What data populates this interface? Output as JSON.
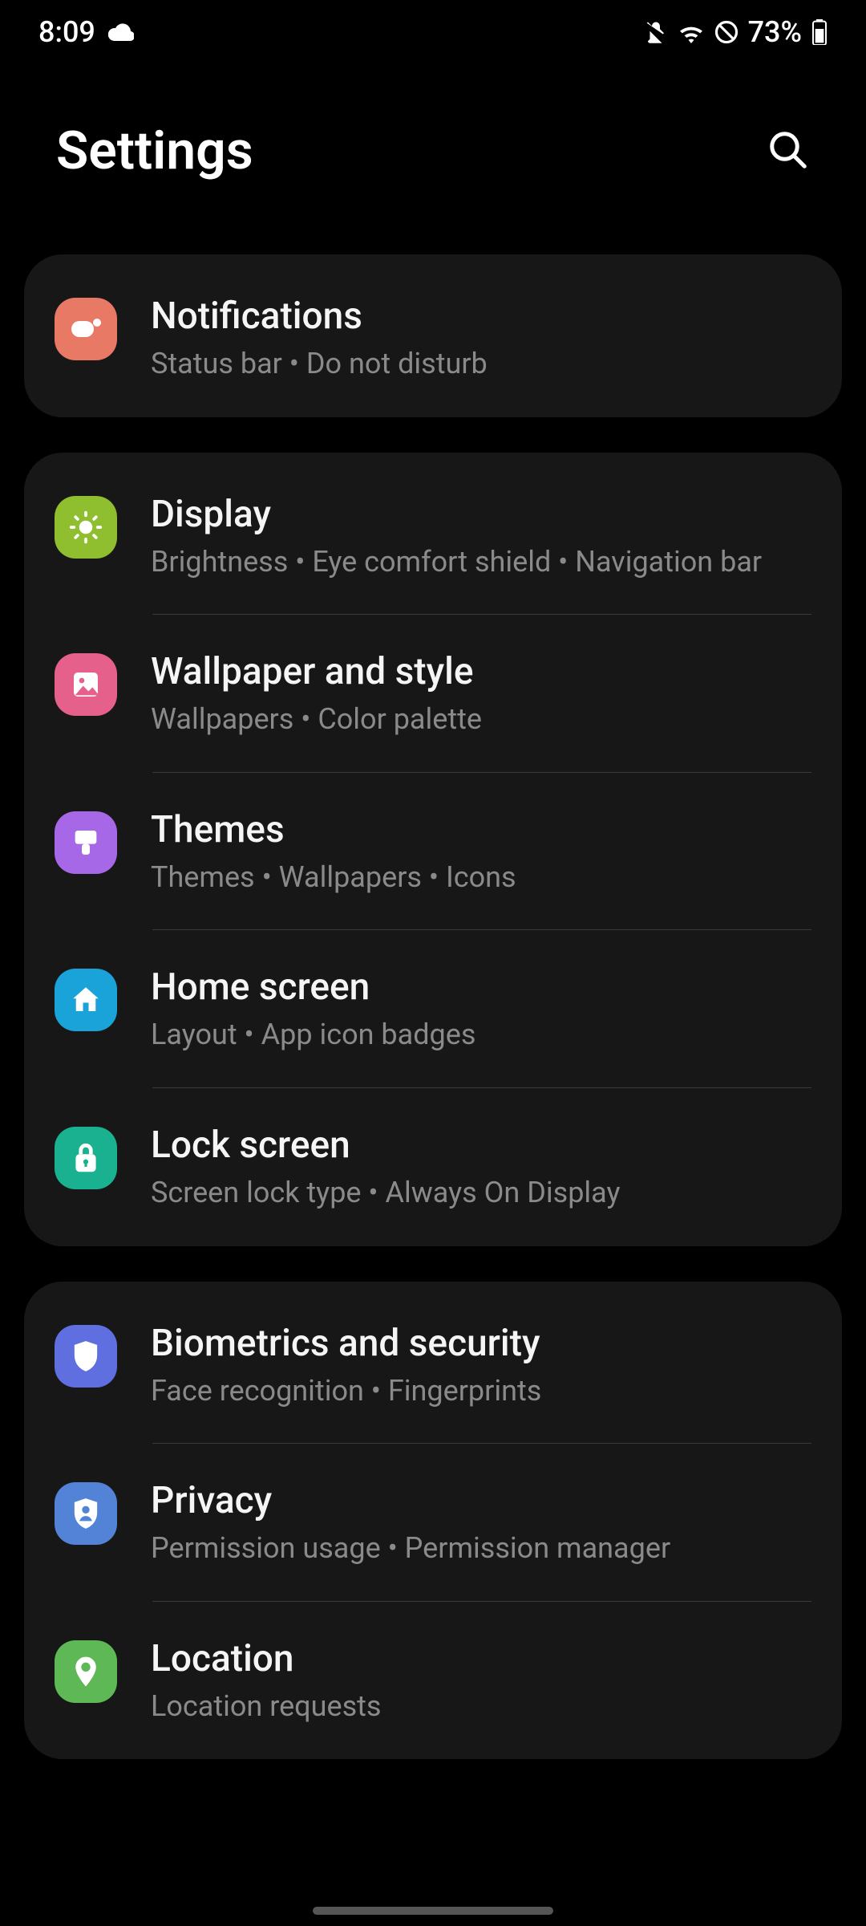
{
  "status": {
    "time": "8:09",
    "battery": "73%"
  },
  "header": {
    "title": "Settings"
  },
  "groups": [
    {
      "items": [
        {
          "icon": "notifications",
          "color": "#E87965",
          "title": "Notifications",
          "sub": "Status bar  •  Do not disturb"
        }
      ]
    },
    {
      "items": [
        {
          "icon": "display",
          "color": "#8FBE2E",
          "title": "Display",
          "sub": "Brightness  •  Eye comfort shield  •  Navigation bar"
        },
        {
          "icon": "wallpaper",
          "color": "#E6608C",
          "title": "Wallpaper and style",
          "sub": "Wallpapers  •  Color palette"
        },
        {
          "icon": "themes",
          "color": "#A768E8",
          "title": "Themes",
          "sub": "Themes  •  Wallpapers  •  Icons"
        },
        {
          "icon": "home",
          "color": "#1AA3D9",
          "title": "Home screen",
          "sub": "Layout  •  App icon badges"
        },
        {
          "icon": "lock",
          "color": "#19B18F",
          "title": "Lock screen",
          "sub": "Screen lock type  •  Always On Display"
        }
      ]
    },
    {
      "items": [
        {
          "icon": "shield",
          "color": "#5F6FE0",
          "title": "Biometrics and security",
          "sub": "Face recognition  •  Fingerprints"
        },
        {
          "icon": "privacy",
          "color": "#5383D6",
          "title": "Privacy",
          "sub": "Permission usage  •  Permission manager"
        },
        {
          "icon": "location",
          "color": "#5FB856",
          "title": "Location",
          "sub": "Location requests"
        }
      ]
    }
  ]
}
